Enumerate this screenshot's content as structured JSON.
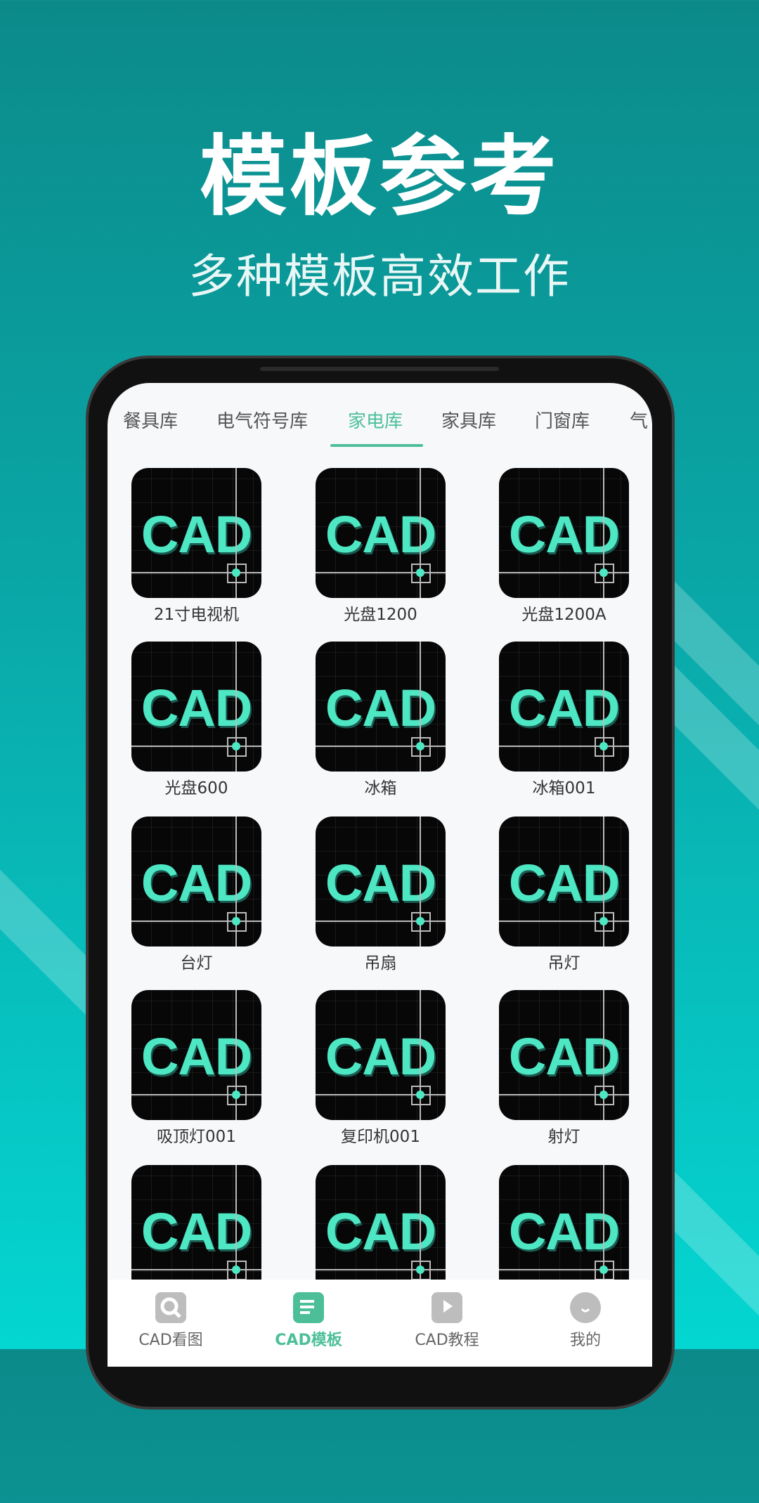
{
  "header": {
    "title": "模板参考",
    "subtitle": "多种模板高效工作"
  },
  "tabs": [
    {
      "label": "餐具库"
    },
    {
      "label": "电气符号库"
    },
    {
      "label": "家电库",
      "active": true
    },
    {
      "label": "家具库"
    },
    {
      "label": "门窗库"
    },
    {
      "label": "气"
    }
  ],
  "icon_text": "CAD",
  "items": [
    {
      "label": "21寸电视机"
    },
    {
      "label": "光盘1200"
    },
    {
      "label": "光盘1200A"
    },
    {
      "label": "光盘600"
    },
    {
      "label": "冰箱"
    },
    {
      "label": "冰箱001"
    },
    {
      "label": "台灯"
    },
    {
      "label": "吊扇"
    },
    {
      "label": "吊灯"
    },
    {
      "label": "吸顶灯001"
    },
    {
      "label": "复印机001"
    },
    {
      "label": "射灯"
    },
    {
      "label": ""
    },
    {
      "label": ""
    },
    {
      "label": ""
    }
  ],
  "nav": [
    {
      "label": "CAD看图",
      "icon": "search-icon"
    },
    {
      "label": "CAD模板",
      "icon": "document-icon",
      "active": true
    },
    {
      "label": "CAD教程",
      "icon": "play-icon"
    },
    {
      "label": "我的",
      "icon": "user-icon"
    }
  ],
  "colors": {
    "accent": "#4cbf98",
    "icon_text": "#4ee7c4",
    "bg_top": "#0c8a8a",
    "bg_bottom": "#04d6d2"
  }
}
